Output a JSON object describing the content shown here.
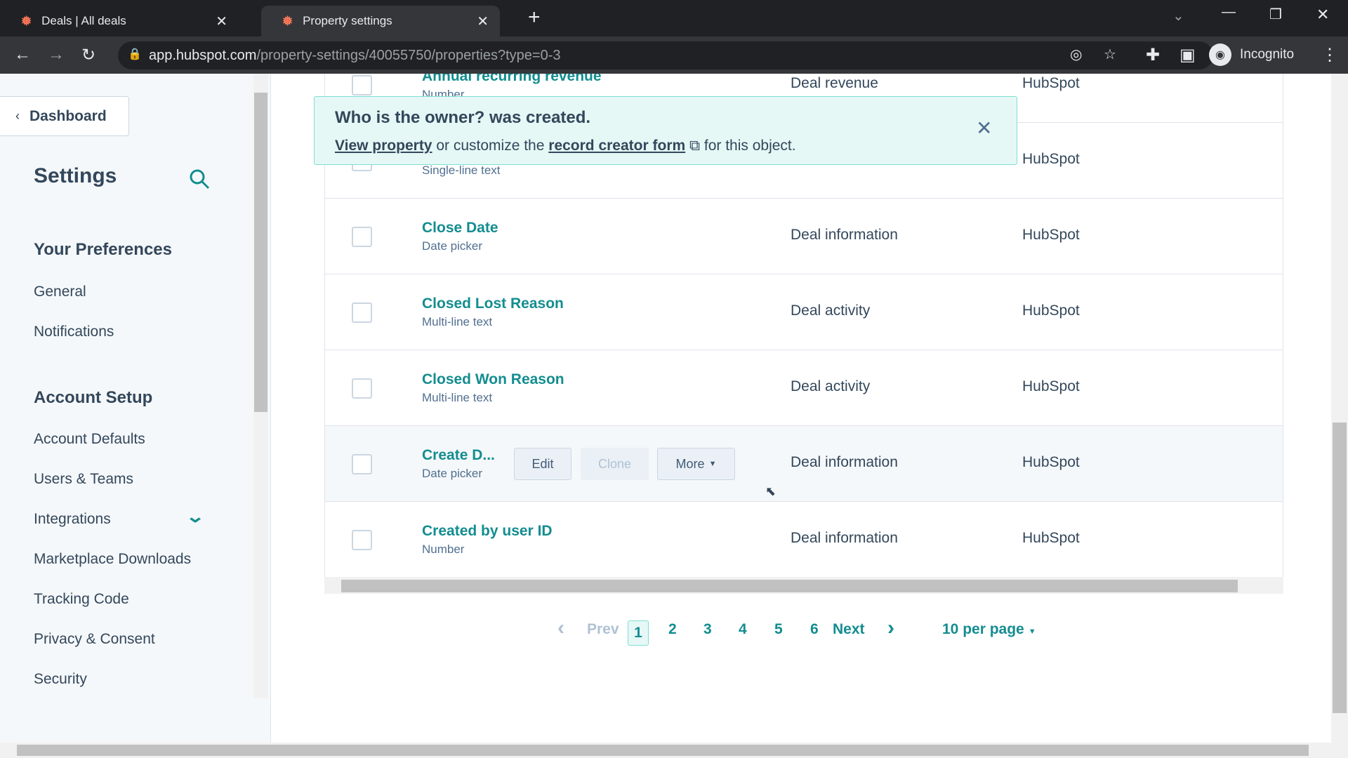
{
  "browser": {
    "tabs": [
      {
        "title": "Deals | All deals",
        "icon": "hubspot-sprocket-icon",
        "active": false
      },
      {
        "title": "Property settings",
        "icon": "hubspot-sprocket-icon",
        "active": true
      }
    ],
    "url_domain": "app.hubspot.com",
    "url_path": "/property-settings/40055750/properties?type=0-3",
    "profile_label": "Incognito"
  },
  "sidebar": {
    "back_label": "Dashboard",
    "title": "Settings",
    "sections": [
      {
        "heading": "Your Preferences",
        "items": [
          "General",
          "Notifications"
        ]
      },
      {
        "heading": "Account Setup",
        "items": [
          "Account Defaults",
          "Users & Teams",
          "Integrations",
          "Marketplace Downloads",
          "Tracking Code",
          "Privacy & Consent",
          "Security"
        ]
      }
    ]
  },
  "banner": {
    "title": "Who is the owner? was created.",
    "link1": "View property",
    "middle": "or customize the",
    "link2": "record creator form",
    "end": "for this object."
  },
  "rows": [
    {
      "name": "Annual recurring revenue",
      "type": "Number",
      "group": "Deal revenue",
      "source": "HubSpot"
    },
    {
      "name": "",
      "type": "Single-line text",
      "group": "",
      "source": "HubSpot"
    },
    {
      "name": "Close Date",
      "type": "Date picker",
      "group": "Deal information",
      "source": "HubSpot"
    },
    {
      "name": "Closed Lost Reason",
      "type": "Multi-line text",
      "group": "Deal activity",
      "source": "HubSpot"
    },
    {
      "name": "Closed Won Reason",
      "type": "Multi-line text",
      "group": "Deal activity",
      "source": "HubSpot"
    },
    {
      "name": "Create D...",
      "type": "Date picker",
      "group": "Deal information",
      "source": "HubSpot"
    },
    {
      "name": "Created by user ID",
      "type": "Number",
      "group": "Deal information",
      "source": "HubSpot"
    }
  ],
  "row_actions": {
    "edit": "Edit",
    "clone": "Clone",
    "more": "More"
  },
  "pagination": {
    "prev": "Prev",
    "next": "Next",
    "pages": [
      "1",
      "2",
      "3",
      "4",
      "5",
      "6"
    ],
    "current": "1",
    "per_page": "10 per page"
  },
  "colors": {
    "link": "#138d90",
    "banner_bg": "#e5f8f6",
    "hubspot_orange": "#ff7a59"
  }
}
